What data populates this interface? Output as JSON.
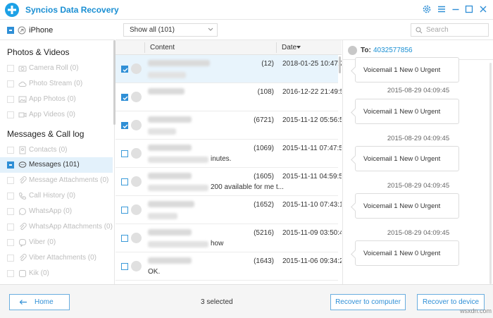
{
  "app": {
    "title": "Syncios Data Recovery"
  },
  "window_controls": [
    "gear-icon",
    "menu-icon",
    "minimize-icon",
    "maximize-icon",
    "close-icon"
  ],
  "device": {
    "name": "iPhone",
    "checkbox": "partial"
  },
  "sidebar": {
    "section1": "Photos & Videos",
    "photos": [
      {
        "label": "Camera Roll (0)",
        "icon": "camera-icon"
      },
      {
        "label": "Photo Stream (0)",
        "icon": "cloud-icon"
      },
      {
        "label": "App Photos (0)",
        "icon": "image-icon"
      },
      {
        "label": "App Videos (0)",
        "icon": "video-icon"
      }
    ],
    "section2": "Messages & Call log",
    "messages": [
      {
        "label": "Contacts (0)",
        "icon": "contacts-icon"
      },
      {
        "label": "Messages (101)",
        "icon": "chat-icon",
        "active": true
      },
      {
        "label": "Message Attachments (0)",
        "icon": "paperclip-icon"
      },
      {
        "label": "Call History (0)",
        "icon": "phone-icon"
      },
      {
        "label": "WhatsApp (0)",
        "icon": "whatsapp-icon"
      },
      {
        "label": "WhatsApp Attachments (0)",
        "icon": "paperclip-icon"
      },
      {
        "label": "Viber (0)",
        "icon": "viber-icon"
      },
      {
        "label": "Viber Attachments (0)",
        "icon": "paperclip-icon"
      },
      {
        "label": "Kik (0)",
        "icon": "kik-icon"
      }
    ]
  },
  "toolbar": {
    "filter_value": "Show all (101)",
    "search_placeholder": "Search"
  },
  "list": {
    "col_content": "Content",
    "col_date": "Date",
    "sort_icon": "sort-down-icon",
    "rows": [
      {
        "checked": true,
        "count": "(12)",
        "date": "2018-01-25 10:47:21",
        "snippet": "",
        "highlight": true
      },
      {
        "checked": true,
        "count": "(108)",
        "date": "2016-12-22 21:49:56",
        "snippet": ""
      },
      {
        "checked": true,
        "count": "(6721)",
        "date": "2015-11-12 05:56:58",
        "snippet": ""
      },
      {
        "checked": false,
        "count": "(1069)",
        "date": "2015-11-11 07:47:57",
        "snippet": "inutes."
      },
      {
        "checked": false,
        "count": "(1605)",
        "date": "2015-11-11 04:59:53",
        "snippet": "200 available for me t..."
      },
      {
        "checked": false,
        "count": "(1652)",
        "date": "2015-11-10 07:43:12",
        "snippet": ""
      },
      {
        "checked": false,
        "count": "(5216)",
        "date": "2015-11-09 03:50:41",
        "snippet": "how"
      },
      {
        "checked": false,
        "count": "(1643)",
        "date": "2015-11-06 09:34:22",
        "snippet": "OK."
      }
    ]
  },
  "pane": {
    "to_label": "To:",
    "number": "4032577856",
    "messages": [
      {
        "text": "Voicemail 1 New 0 Urgent",
        "stamp": ""
      },
      {
        "text": "Voicemail 1 New 0 Urgent",
        "stamp": "2015-08-29 04:09:45"
      },
      {
        "text": "Voicemail 1 New 0 Urgent",
        "stamp": "2015-08-29 04:09:45"
      },
      {
        "text": "Voicemail 1 New 0 Urgent",
        "stamp": "2015-08-29 04:09:45"
      },
      {
        "text": "Voicemail 1 New 0 Urgent",
        "stamp": "2015-08-29 04:09:45"
      }
    ]
  },
  "footer": {
    "home_label": "Home",
    "selected_text": "3 selected",
    "recover_computer": "Recover to computer",
    "recover_device": "Recover to device"
  },
  "watermark": "wsxdn.com"
}
